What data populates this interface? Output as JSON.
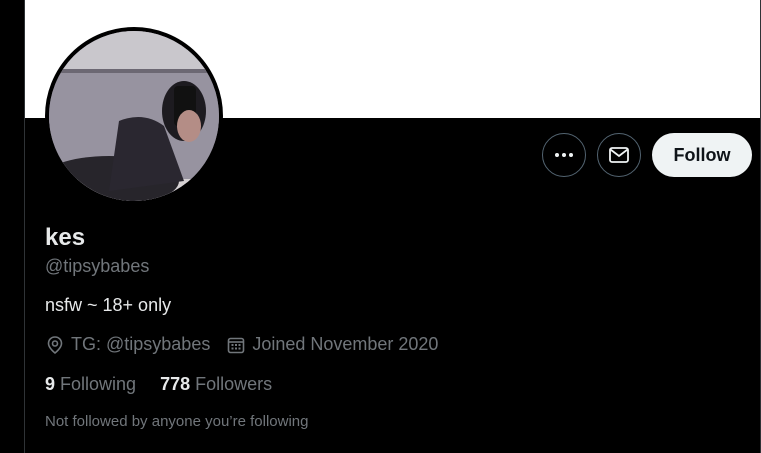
{
  "profile": {
    "name": "kes",
    "handle": "@tipsybabes",
    "bio": "nsfw ~ 18+ only",
    "location": "TG: @tipsybabes",
    "joined": "Joined November 2020",
    "following_count": "9",
    "following_label": "Following",
    "followers_count": "778",
    "followers_label": "Followers",
    "not_followed_text": "Not followed by anyone you’re following"
  },
  "actions": {
    "follow_label": "Follow",
    "more_icon": "more-icon",
    "message_icon": "envelope-icon"
  },
  "colors": {
    "background": "#000000",
    "banner": "#ffffff",
    "secondary_text": "#71767b",
    "follow_button": "#eff3f4"
  }
}
